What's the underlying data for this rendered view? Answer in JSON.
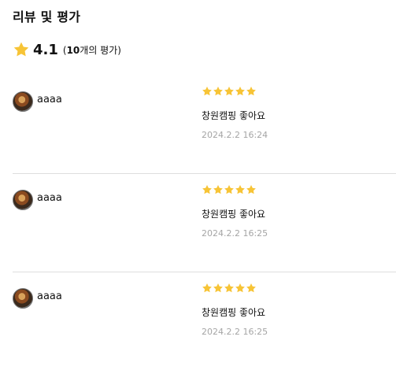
{
  "section": {
    "title": "리뷰 및 평가"
  },
  "summary": {
    "rating": "4.1",
    "count_open": "(",
    "count_number": "10",
    "count_suffix": "개의 평가)"
  },
  "colors": {
    "star": "#f7c436",
    "date": "#a5a5a5",
    "divider": "#dedede"
  },
  "reviews": [
    {
      "user": "aaaa",
      "stars": 5,
      "content": "창원캠핑 좋아요",
      "date": "2024.2.2 16:24"
    },
    {
      "user": "aaaa",
      "stars": 5,
      "content": "창원캠핑 좋아요",
      "date": "2024.2.2 16:25"
    },
    {
      "user": "aaaa",
      "stars": 5,
      "content": "창원캠핑 좋아요",
      "date": "2024.2.2 16:25"
    }
  ],
  "icons": {
    "rating_star": "star-icon",
    "review_star": "star-icon",
    "avatar": "avatar-image"
  }
}
